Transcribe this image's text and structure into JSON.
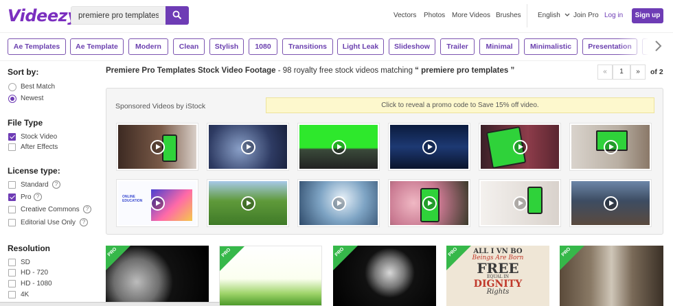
{
  "header": {
    "logo": "Videezy",
    "search_value": "premiere pro templates",
    "nav": [
      "Vectors",
      "Photos",
      "More Videos",
      "Brushes"
    ],
    "language": "English",
    "join_pro": "Join Pro",
    "login": "Log in",
    "signup": "Sign up",
    "icons": {
      "search": "search-icon",
      "language_dropdown": "chevron-down-icon"
    }
  },
  "tags": [
    "Ae Templates",
    "Ae Template",
    "Modern",
    "Clean",
    "Stylish",
    "1080",
    "Transitions",
    "Light Leak",
    "Slideshow",
    "Trailer",
    "Minimal",
    "Minimalistic",
    "Presentation"
  ],
  "sidebar": {
    "sort_title": "Sort by:",
    "sort_options": [
      "Best Match",
      "Newest"
    ],
    "sort_selected": "Newest",
    "filetype_title": "File Type",
    "filetype_options": [
      "Stock Video",
      "After Effects"
    ],
    "license_title": "License type:",
    "license_options": [
      "Standard",
      "Pro",
      "Creative Commons",
      "Editorial Use Only"
    ],
    "resolution_title": "Resolution",
    "resolution_options": [
      "SD",
      "HD - 720",
      "HD - 1080",
      "4K"
    ]
  },
  "results": {
    "title": "Premiere Pro Templates Stock Video Footage",
    "summary": " - 98 royalty free stock videos matching ",
    "query_quoted": "“ premiere pro templates ”",
    "pagination": {
      "first": "«",
      "current": "1",
      "next": "»",
      "of": "of 2"
    }
  },
  "sponsored": {
    "title": "Sponsored Videos by iStock",
    "promo": "Click to reveal a promo code to Save 15% off video.",
    "education_label": "ONLINE EDUCATION"
  },
  "results_grid": {
    "badge": "PRO",
    "poster_lines": [
      "ALL I VN BO",
      "Beings Are Born",
      "FREE",
      "EQUAL IN",
      "DIGNITY",
      "Rights"
    ]
  },
  "colors": {
    "accent": "#6e3cb5",
    "pro_badge": "#36b84a"
  }
}
